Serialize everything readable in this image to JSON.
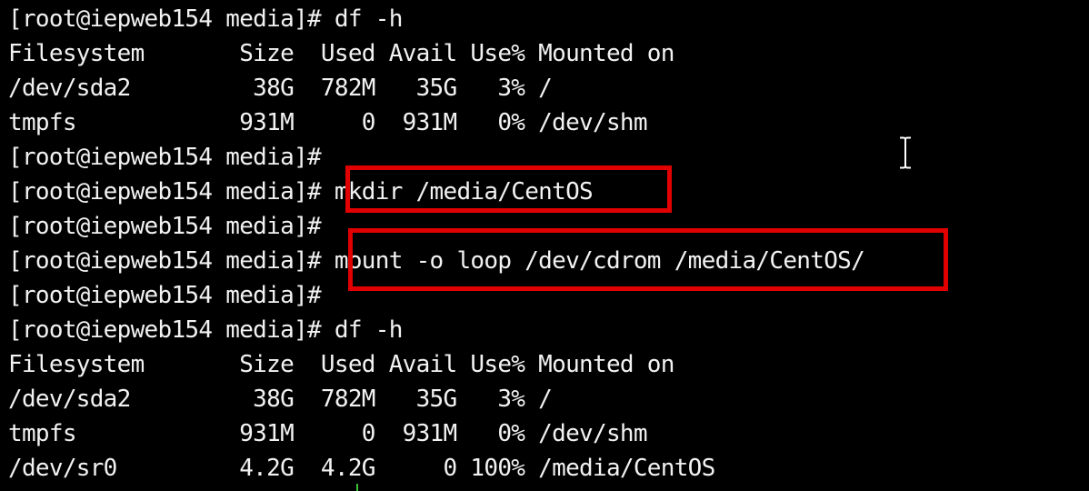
{
  "terminal": {
    "lines": [
      "[root@iepweb154 media]# df -h",
      "Filesystem       Size  Used Avail Use% Mounted on",
      "/dev/sda2         38G  782M   35G   3% /",
      "tmpfs            931M     0  931M   0% /dev/shm",
      "[root@iepweb154 media]#",
      "[root@iepweb154 media]# mkdir /media/CentOS",
      "[root@iepweb154 media]#",
      "[root@iepweb154 media]# mount -o loop /dev/cdrom /media/CentOS/",
      "[root@iepweb154 media]#",
      "[root@iepweb154 media]# df -h",
      "Filesystem       Size  Used Avail Use% Mounted on",
      "/dev/sda2         38G  782M   35G   3% /",
      "tmpfs            931M     0  931M   0% /dev/shm",
      "/dev/sr0         4.2G  4.2G     0 100% /media/CentOS"
    ]
  },
  "colors": {
    "background": "#000000",
    "text": "#f2f2f2",
    "highlight": "#e10000"
  },
  "icons": {
    "cursor": "i-beam-cursor-icon"
  }
}
